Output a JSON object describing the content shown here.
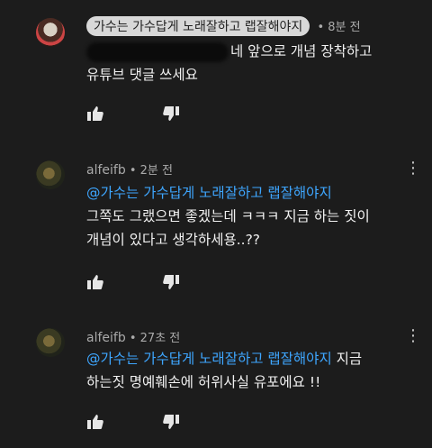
{
  "comments": [
    {
      "chip_name": "가수는 가수답게 노래잘하고 랩잘해야지",
      "time": " • 8분 전",
      "line1": "네 앞으로 개념 장착하고",
      "line2": "유튜브 댓글 쓰세요"
    },
    {
      "author": "alfeifb",
      "time": " • 2분 전",
      "mention": "@가수는 가수답게 노래잘하고 랩잘해야지",
      "line1": "그쪽도 그랬으면 좋겠는데 ㅋㅋㅋ 지금 하는 짓이",
      "line2": "개념이 있다고 생각하세용..??"
    },
    {
      "author": "alfeifb",
      "time": " • 27초 전",
      "mention": "@가수는 가수답게 노래잘하고 랩잘해야지",
      "trail": " 지금",
      "line2": "하는짓 명예훼손에 허위사실 유포에요 !!"
    }
  ],
  "icons": [
    "like-icon",
    "dislike-icon",
    "more-icon"
  ],
  "colors": {
    "background": "#1c1c1c",
    "mention": "#3ea6ff",
    "meta": "#aaaaaa"
  }
}
